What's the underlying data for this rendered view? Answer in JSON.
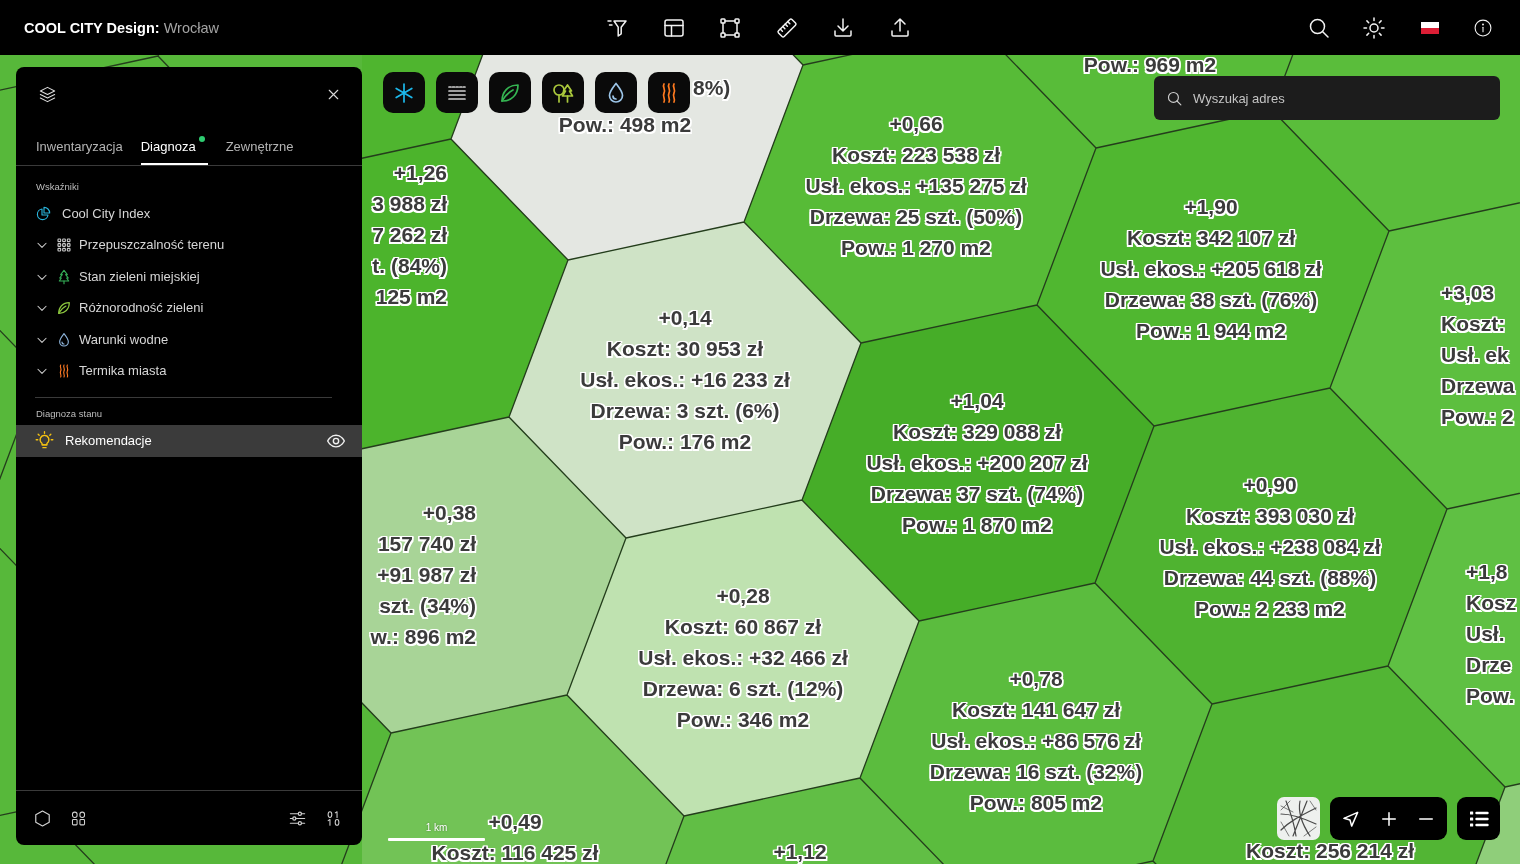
{
  "header": {
    "app_name": "COOL CITY Design:",
    "city": "Wrocław"
  },
  "sidebar": {
    "tabs": [
      {
        "label": "Inwentaryzacja",
        "selected": false,
        "dot": false
      },
      {
        "label": "Diagnoza",
        "selected": true,
        "dot": true
      },
      {
        "label": "Zewnętrzne",
        "selected": false,
        "dot": false
      }
    ],
    "sections": [
      {
        "title": "Wskaźniki",
        "items": [
          {
            "label": "Cool City Index",
            "kind": "index",
            "expandable": false,
            "selected": false,
            "visible": false
          },
          {
            "label": "Przepuszczalność terenu",
            "kind": "permeability",
            "expandable": true,
            "selected": false,
            "visible": false
          },
          {
            "label": "Stan zieleni miejskiej",
            "kind": "greenery",
            "expandable": true,
            "selected": false,
            "visible": false
          },
          {
            "label": "Różnorodność zieleni",
            "kind": "biodiversity",
            "expandable": true,
            "selected": false,
            "visible": false
          },
          {
            "label": "Warunki wodne",
            "kind": "water",
            "expandable": true,
            "selected": false,
            "visible": false
          },
          {
            "label": "Termika miasta",
            "kind": "thermal",
            "expandable": true,
            "selected": false,
            "visible": false
          }
        ]
      },
      {
        "title": "Diagnoza stanu",
        "items": [
          {
            "label": "Rekomendacje",
            "kind": "recommendation",
            "expandable": false,
            "selected": true,
            "visible": true
          }
        ]
      }
    ]
  },
  "layer_toolbar": [
    {
      "kind": "cooling"
    },
    {
      "kind": "surfaces"
    },
    {
      "kind": "biodiversity"
    },
    {
      "kind": "greenery"
    },
    {
      "kind": "water"
    },
    {
      "kind": "thermal"
    }
  ],
  "search": {
    "placeholder": "Wyszukaj adres"
  },
  "map": {
    "hexes": [
      {
        "color": "#4fb52f"
      },
      {
        "color": "#58bc39",
        "label": {
          "area": "Pow.: 969 m2"
        }
      },
      {
        "color": "#5abd3b"
      },
      {
        "color": "#e4e7e2",
        "label": {
          "trees": "8%)",
          "area": "Pow.: 498 m2"
        }
      },
      {
        "color": "#57bb37",
        "label": {
          "score": "+0,66",
          "cost": "Koszt: 223 538 zł",
          "eco": "Usł. ekos.: +135 275 zł",
          "trees": "Drzewa: 25 szt. (50%)",
          "area": "Pow.: 1 270 m2"
        }
      },
      {
        "color": "#4cb42c",
        "label": {
          "score": "+1,26",
          "cost": "3 988 zł",
          "eco": "7 262 zł",
          "trees": "t. (84%)",
          "area": "125 m2"
        }
      },
      {
        "color": "#50b730",
        "label": {
          "score": "+1,90",
          "cost": "Koszt: 342 107 zł",
          "eco": "Usł. ekos.: +205 618 zł",
          "trees": "Drzewa: 38 szt. (76%)",
          "area": "Pow.: 1 944 m2"
        }
      },
      {
        "color": "#5dbf3f",
        "label": {
          "score": "+3,03",
          "cost": "Koszt:",
          "eco": "Usł. ek",
          "trees": "Drzewa",
          "area": "Pow.: 2"
        }
      },
      {
        "color": "#cfe3c6",
        "label": {
          "score": "+0,14",
          "cost": "Koszt: 30 953 zł",
          "eco": "Usł. ekos.: +16 233 zł",
          "trees": "Drzewa: 3 szt. (6%)",
          "area": "Pow.: 176 m2"
        }
      },
      {
        "color": "#46ad28",
        "label": {
          "score": "+1,04",
          "cost": "Koszt: 329 088 zł",
          "eco": "Usł. ekos.: +200 207 zł",
          "trees": "Drzewa: 37 szt. (74%)",
          "area": "Pow.: 1 870 m2"
        }
      },
      {
        "color": "#4fb330",
        "label": {
          "score": "+0,90",
          "cost": "Koszt: 393 030 zł",
          "eco": "Usł. ekos.: +238 084 zł",
          "trees": "Drzewa: 44 szt. (88%)",
          "area": "Pow.: 2 233 m2"
        }
      },
      {
        "color": "#a8d497",
        "label": {
          "score": "+0,38",
          "cost": "157 740 zł",
          "eco": "+91 987 zł",
          "trees": "szt. (34%)",
          "area": "w.: 896 m2"
        }
      },
      {
        "color": "#5fc043",
        "label": {
          "score": "+1,8",
          "cost": "Kosz",
          "eco": "Usł.",
          "trees": "Drze",
          "area": "Pow."
        }
      },
      {
        "color": "#bfe2b0",
        "label": {
          "score": "+0,28",
          "cost": "Koszt: 60 867 zł",
          "eco": "Usł. ekos.: +32 466 zł",
          "trees": "Drzewa: 6 szt. (12%)",
          "area": "Pow.: 346 m2"
        }
      },
      {
        "color": "#5bbc3e",
        "label": {
          "score": "+0,78",
          "cost": "Koszt: 141 647 zł",
          "eco": "Usł. ekos.: +86 576 zł",
          "trees": "Drzewa: 16 szt. (32%)",
          "area": "Pow.: 805 m2"
        }
      },
      {
        "color": "#72c356",
        "label": {
          "score": "+0,49",
          "cost": "Koszt: 116 425 zł"
        }
      },
      {
        "color": "#61be45",
        "label": {
          "score": "+1,12"
        }
      },
      {
        "color": "#52b534",
        "label": {
          "cost": "Koszt: 256 214 zł"
        }
      },
      {
        "color": "#8fce7a"
      }
    ],
    "scale_label": "1 km"
  }
}
